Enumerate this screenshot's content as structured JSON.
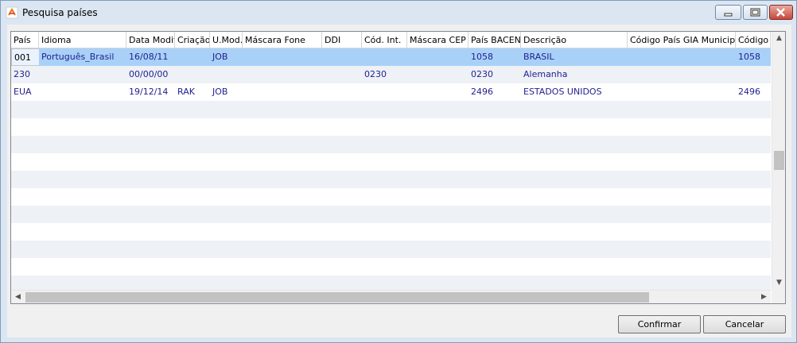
{
  "window": {
    "title": "Pesquisa países"
  },
  "grid": {
    "columns": [
      "País",
      "Idioma",
      "Data Modif.",
      "Criação",
      "U.Mod.",
      "Máscara Fone",
      "DDI",
      "Cód. Int.",
      "Máscara CEP",
      "País BACEN",
      "Descrição",
      "Código País GIA Municipal",
      "Código"
    ],
    "rows": [
      [
        "001",
        "Português_Brasil",
        "16/08/11",
        "",
        "JOB",
        "",
        "",
        "",
        "",
        "1058",
        "BRASIL",
        "",
        "1058"
      ],
      [
        "230",
        "",
        "00/00/00",
        "",
        "",
        "",
        "",
        "0230",
        "",
        "0230",
        "Alemanha",
        "",
        ""
      ],
      [
        "EUA",
        "",
        "19/12/14",
        "RAK",
        "JOB",
        "",
        "",
        "",
        "",
        "2496",
        "ESTADOS UNIDOS",
        "",
        "2496"
      ]
    ],
    "selected_row": 0
  },
  "buttons": {
    "confirm": "Confirmar",
    "cancel": "Cancelar"
  },
  "colors": {
    "selection": "#a9d1f7",
    "text": "#1f1f8f",
    "alt_row": "#eef1f5"
  },
  "icons": [
    "app-icon",
    "minimize-icon",
    "maximize-icon",
    "close-icon",
    "scroll-up-icon",
    "scroll-down-icon",
    "scroll-left-icon",
    "scroll-right-icon"
  ]
}
